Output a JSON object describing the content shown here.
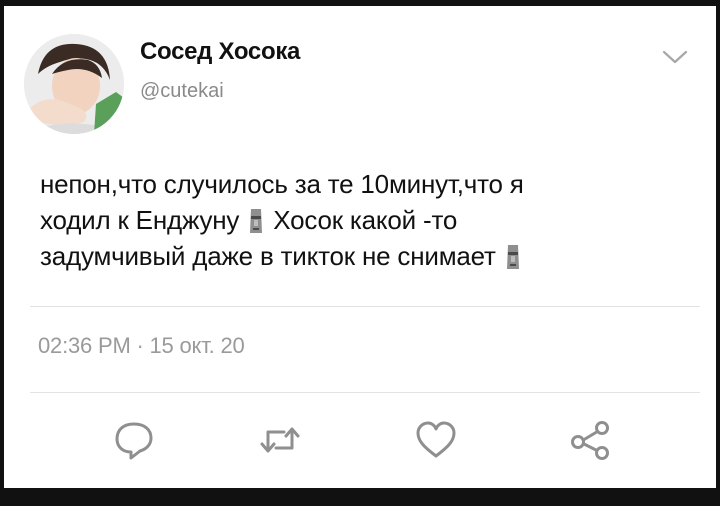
{
  "tweet": {
    "author_name": "Сосед Хосока",
    "handle": "@cutekai",
    "text_lines": [
      "непон,что случилось за те 10минут,что я",
      "ходил к Енджуну",
      "Хосок какой -то",
      "задумчивый даже в тикток не снимает"
    ],
    "emoji": "moai-icon",
    "timestamp": "02:36 PM · 15 окт. 20"
  },
  "actions": [
    {
      "name": "reply",
      "icon": "speech-bubble-icon"
    },
    {
      "name": "retweet",
      "icon": "retweet-icon"
    },
    {
      "name": "like",
      "icon": "heart-icon"
    },
    {
      "name": "share",
      "icon": "share-icon"
    }
  ],
  "colors": {
    "text": "#111111",
    "muted": "#8a8a8a",
    "divider": "#e3e3e3",
    "frame": "#111111"
  }
}
